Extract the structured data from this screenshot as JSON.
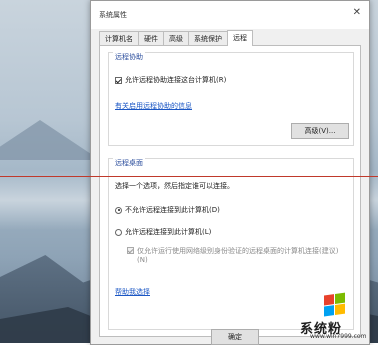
{
  "window": {
    "title": "系统属性",
    "close_glyph": "✕"
  },
  "tabs": [
    {
      "label": "计算机名",
      "active": false
    },
    {
      "label": "硬件",
      "active": false
    },
    {
      "label": "高级",
      "active": false
    },
    {
      "label": "系统保护",
      "active": false
    },
    {
      "label": "远程",
      "active": true
    }
  ],
  "remote_assistance": {
    "group_label": "远程协助",
    "allow_checkbox_label": "允许远程协助连接这台计算机(R)",
    "allow_checked": true,
    "link_text": "有关启用远程协助的信息",
    "advanced_button": "高级(V)..."
  },
  "remote_desktop": {
    "group_label": "远程桌面",
    "instruction": "选择一个选项，然后指定谁可以连接。",
    "option_disallow": "不允许远程连接到此计算机(D)",
    "option_allow": "允许远程连接到此计算机(L)",
    "selected": "disallow",
    "nla_label": "仅允许运行使用网络级别身份验证的远程桌面的计算机连接(建议)",
    "nla_suffix": "(N)",
    "nla_checked": true,
    "help_link": "帮助我选择"
  },
  "footer": {
    "ok_button": "确定"
  },
  "watermark": {
    "brand": "系统粉",
    "site": "www.win7999.com"
  },
  "colors": {
    "red_line": "#c0392b",
    "link": "#1a56c4",
    "group_label": "#2d4f9e"
  }
}
